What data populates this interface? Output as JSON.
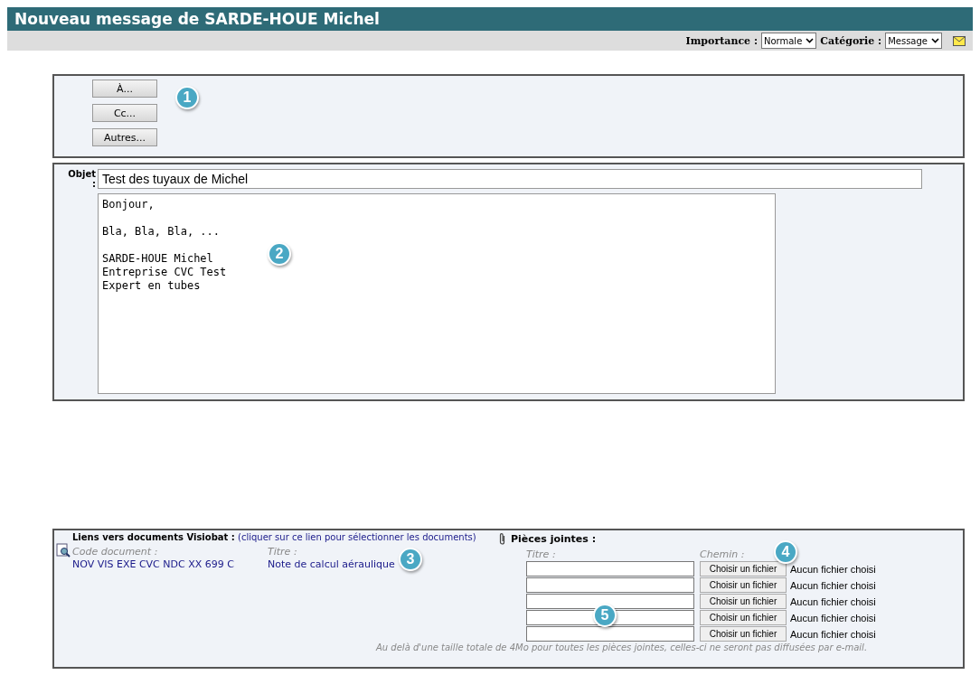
{
  "window": {
    "title": "Nouveau message de SARDE-HOUE Michel"
  },
  "toolbar": {
    "importance_label": "Importance :",
    "importance_value": "Normale",
    "category_label": "Catégorie :",
    "category_value": "Message"
  },
  "recipient_buttons": [
    "À...",
    "Cc...",
    "Autres..."
  ],
  "message": {
    "subject_label": "Objet :",
    "subject": "Test des tuyaux de Michel",
    "body_paragraphs": [
      [
        "Bonjour,"
      ],
      [
        "Bla, Bla, Bla, ..."
      ],
      [
        "SARDE-HOUE Michel",
        "Entreprise CVC Test",
        "Expert en tubes"
      ]
    ]
  },
  "documents": {
    "title": "Liens vers documents Visiobat :",
    "link": "(cliquer sur ce lien pour sélectionner les documents)",
    "columns": [
      "Code document :",
      "Titre :"
    ],
    "rows": [
      {
        "code": "NOV VIS EXE CVC NDC XX 699 C",
        "title": "Note de calcul aéraulique"
      }
    ]
  },
  "attachments": {
    "title": "Pièces jointes :",
    "columns": [
      "Titre :",
      "Chemin :"
    ],
    "rows": [
      {
        "button": "Choisir un fichier",
        "status": "Aucun fichier choisi"
      },
      {
        "button": "Choisir un fichier",
        "status": "Aucun fichier choisi"
      },
      {
        "button": "Choisir un fichier",
        "status": "Aucun fichier choisi"
      },
      {
        "button": "Choisir un fichier",
        "status": "Aucun fichier choisi"
      },
      {
        "button": "Choisir un fichier",
        "status": "Aucun fichier choisi"
      }
    ],
    "note": "Au delà d'une taille totale de 4Mo pour toutes les pièces jointes, celles-ci ne seront pas diffusées par e-mail."
  },
  "callouts": [
    "1",
    "2",
    "3",
    "4",
    "5"
  ]
}
